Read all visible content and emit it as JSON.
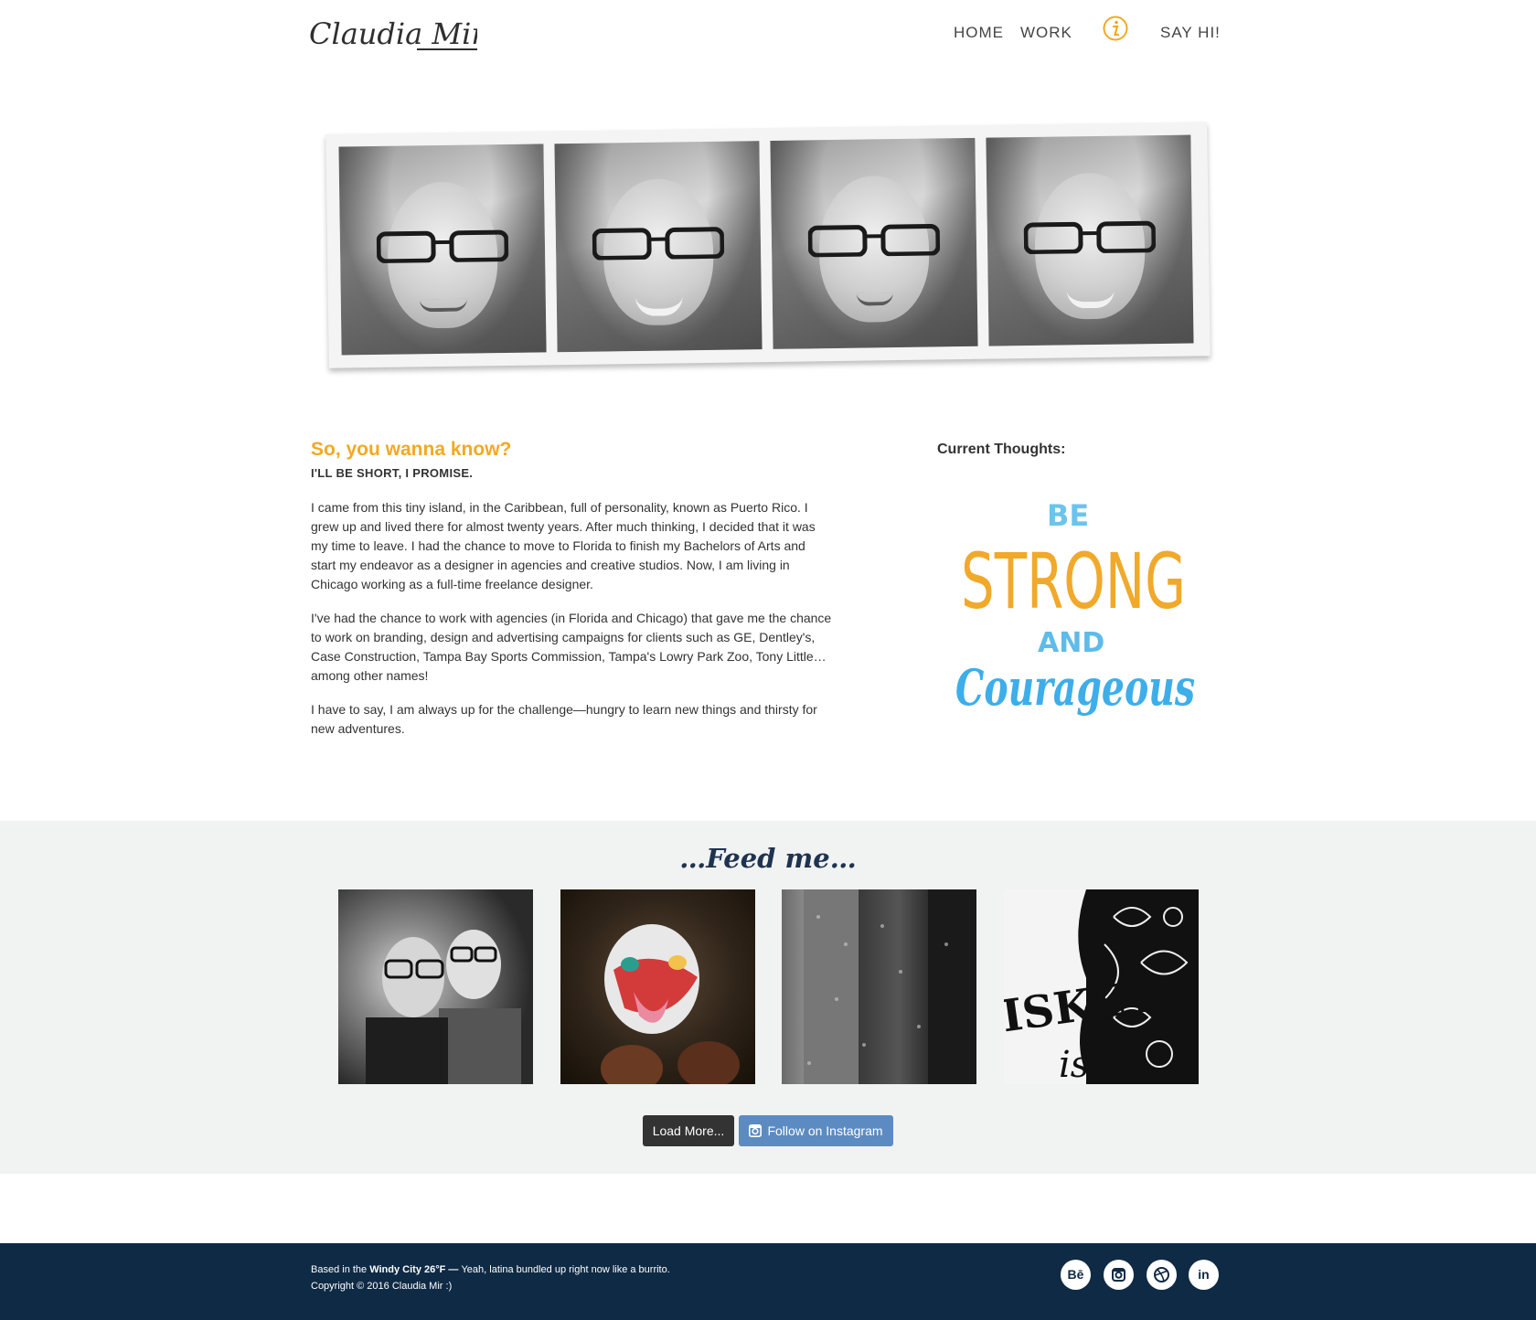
{
  "header": {
    "logo_text": "Claudia Mir",
    "nav": {
      "home": "HOME",
      "work": "WORK",
      "info_icon": "info-icon",
      "say_hi": "SAY HI!"
    }
  },
  "strip": {
    "photos": [
      "portrait-1",
      "portrait-2",
      "portrait-3",
      "portrait-4"
    ]
  },
  "about": {
    "title": "So, you wanna know?",
    "subtitle": "I'LL BE SHORT, I PROMISE.",
    "paragraphs": [
      "I came from this tiny island, in the Caribbean, full of personality, known as Puerto Rico. I grew up and lived there for almost twenty years. After much thinking, I decided that it was my time to leave. I had the chance to move to Florida to finish my Bachelors of Arts and start my endeavor as a designer in agencies and creative studios. Now, I am living in Chicago working as a full-time freelance designer.",
      "I've had the chance to work with agencies (in Florida and Chicago) that gave me the chance to work on branding, design and advertising campaigns for clients such as GE, Dentley's, Case Construction, Tampa Bay Sports Commission, Tampa's Lowry Park Zoo, Tony Little… among other names!",
      "I have to say, I am always up for the challenge—hungry to learn new things and thirsty for new adventures."
    ]
  },
  "thoughts": {
    "title": "Current Thoughts:",
    "art_line1": "BE",
    "art_line2": "STRONG",
    "art_line3": "AND",
    "art_line4": "Courageous"
  },
  "feed": {
    "title": "…Feed me…",
    "load_more": "Load More...",
    "follow": "Follow on Instagram",
    "follow_icon": "instagram-icon",
    "feed4_text1": "ISKEY",
    "feed4_text2": "is"
  },
  "footer": {
    "line1_prefix": "Based in the ",
    "line1_bold": "Windy City 26°F — ",
    "line1_suffix": "Yeah, latina bundled up right now like a burrito.",
    "line2": "Copyright © 2016 Claudia Mir :)",
    "social": {
      "behance": "Bē",
      "instagram": "instagram-icon",
      "dribbble": "dribbble-icon",
      "linkedin": "in"
    }
  },
  "colors": {
    "accent_orange": "#f2a922",
    "feed_title": "#1e3350",
    "footer_bg": "#0f2a45",
    "follow_button": "#5c8bc1",
    "load_button": "#333333",
    "quote_blue": "#4db6ea"
  }
}
